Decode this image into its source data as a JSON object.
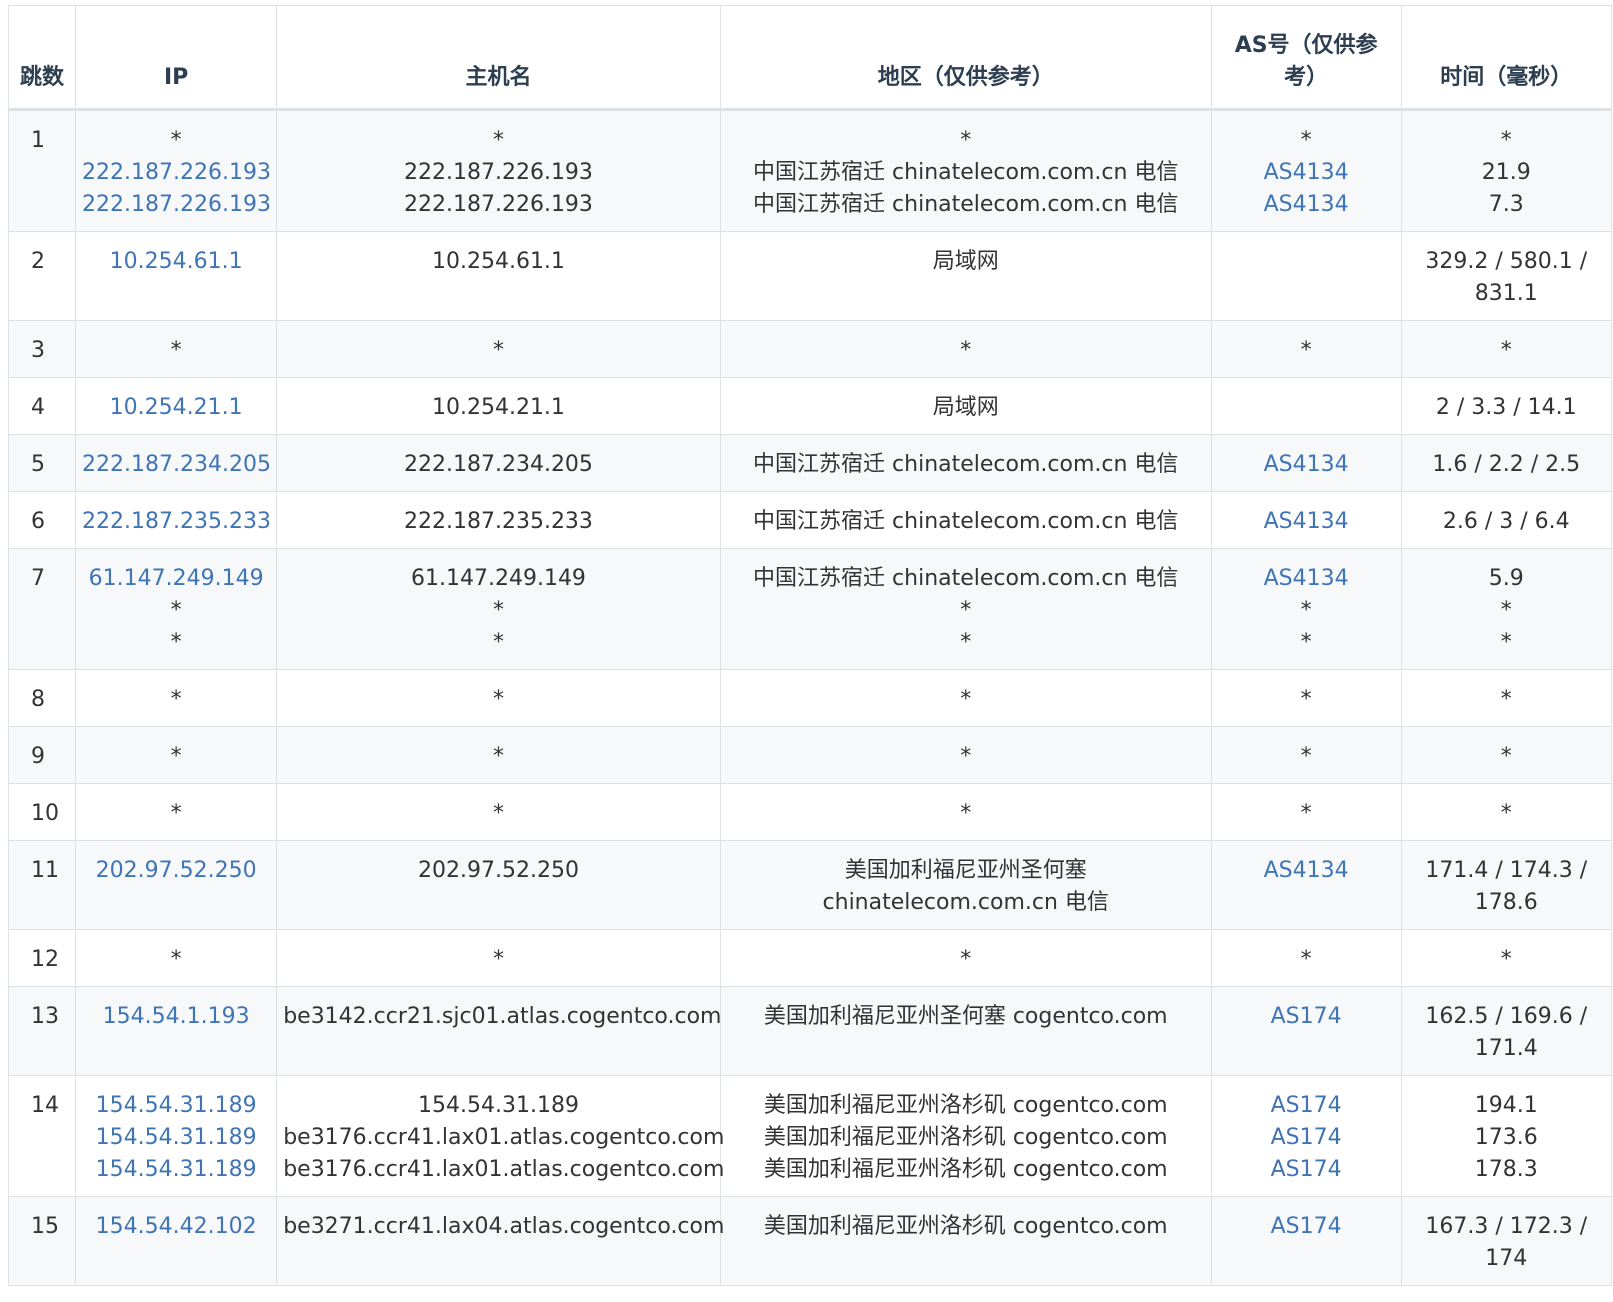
{
  "columns": [
    "跳数",
    "IP",
    "主机名",
    "地区（仅供参考）",
    "AS号（仅供参考）",
    "时间（毫秒）"
  ],
  "rows": [
    {
      "hop": "1",
      "ips": [
        "*",
        "222.187.226.193",
        "222.187.226.193"
      ],
      "hosts": [
        "*",
        "222.187.226.193",
        "222.187.226.193"
      ],
      "regions": [
        "*",
        "中国江苏宿迁 chinatelecom.com.cn 电信",
        "中国江苏宿迁 chinatelecom.com.cn 电信"
      ],
      "asns": [
        "*",
        "AS4134",
        "AS4134"
      ],
      "times": [
        "*",
        "21.9",
        "7.3"
      ]
    },
    {
      "hop": "2",
      "ips": [
        "10.254.61.1"
      ],
      "hosts": [
        "10.254.61.1"
      ],
      "regions": [
        "局域网"
      ],
      "asns": [
        ""
      ],
      "times": [
        "329.2 / 580.1 / 831.1"
      ]
    },
    {
      "hop": "3",
      "ips": [
        "*"
      ],
      "hosts": [
        "*"
      ],
      "regions": [
        "*"
      ],
      "asns": [
        "*"
      ],
      "times": [
        "*"
      ]
    },
    {
      "hop": "4",
      "ips": [
        "10.254.21.1"
      ],
      "hosts": [
        "10.254.21.1"
      ],
      "regions": [
        "局域网"
      ],
      "asns": [
        ""
      ],
      "times": [
        "2 / 3.3 / 14.1"
      ]
    },
    {
      "hop": "5",
      "ips": [
        "222.187.234.205"
      ],
      "hosts": [
        "222.187.234.205"
      ],
      "regions": [
        "中国江苏宿迁 chinatelecom.com.cn 电信"
      ],
      "asns": [
        "AS4134"
      ],
      "times": [
        "1.6 / 2.2 / 2.5"
      ]
    },
    {
      "hop": "6",
      "ips": [
        "222.187.235.233"
      ],
      "hosts": [
        "222.187.235.233"
      ],
      "regions": [
        "中国江苏宿迁 chinatelecom.com.cn 电信"
      ],
      "asns": [
        "AS4134"
      ],
      "times": [
        "2.6 / 3 / 6.4"
      ]
    },
    {
      "hop": "7",
      "ips": [
        "61.147.249.149",
        "*",
        "*"
      ],
      "hosts": [
        "61.147.249.149",
        "*",
        "*"
      ],
      "regions": [
        "中国江苏宿迁 chinatelecom.com.cn 电信",
        "*",
        "*"
      ],
      "asns": [
        "AS4134",
        "*",
        "*"
      ],
      "times": [
        "5.9",
        "*",
        "*"
      ]
    },
    {
      "hop": "8",
      "ips": [
        "*"
      ],
      "hosts": [
        "*"
      ],
      "regions": [
        "*"
      ],
      "asns": [
        "*"
      ],
      "times": [
        "*"
      ]
    },
    {
      "hop": "9",
      "ips": [
        "*"
      ],
      "hosts": [
        "*"
      ],
      "regions": [
        "*"
      ],
      "asns": [
        "*"
      ],
      "times": [
        "*"
      ]
    },
    {
      "hop": "10",
      "ips": [
        "*"
      ],
      "hosts": [
        "*"
      ],
      "regions": [
        "*"
      ],
      "asns": [
        "*"
      ],
      "times": [
        "*"
      ]
    },
    {
      "hop": "11",
      "ips": [
        "202.97.52.250"
      ],
      "hosts": [
        "202.97.52.250"
      ],
      "regions": [
        "美国加利福尼亚州圣何塞 chinatelecom.com.cn 电信"
      ],
      "asns": [
        "AS4134"
      ],
      "times": [
        "171.4 / 174.3 / 178.6"
      ]
    },
    {
      "hop": "12",
      "ips": [
        "*"
      ],
      "hosts": [
        "*"
      ],
      "regions": [
        "*"
      ],
      "asns": [
        "*"
      ],
      "times": [
        "*"
      ]
    },
    {
      "hop": "13",
      "ips": [
        "154.54.1.193"
      ],
      "hosts": [
        "be3142.ccr21.sjc01.atlas.cogentco.com"
      ],
      "regions": [
        "美国加利福尼亚州圣何塞 cogentco.com"
      ],
      "asns": [
        "AS174"
      ],
      "times": [
        "162.5 / 169.6 / 171.4"
      ]
    },
    {
      "hop": "14",
      "ips": [
        "154.54.31.189",
        "154.54.31.189",
        "154.54.31.189"
      ],
      "hosts": [
        "154.54.31.189",
        "be3176.ccr41.lax01.atlas.cogentco.com",
        "be3176.ccr41.lax01.atlas.cogentco.com"
      ],
      "regions": [
        "美国加利福尼亚州洛杉矶 cogentco.com",
        "美国加利福尼亚州洛杉矶 cogentco.com",
        "美国加利福尼亚州洛杉矶 cogentco.com"
      ],
      "asns": [
        "AS174",
        "AS174",
        "AS174"
      ],
      "times": [
        "194.1",
        "173.6",
        "178.3"
      ]
    },
    {
      "hop": "15",
      "ips": [
        "154.54.42.102"
      ],
      "hosts": [
        "be3271.ccr41.lax04.atlas.cogentco.com"
      ],
      "regions": [
        "美国加利福尼亚州洛杉矶 cogentco.com"
      ],
      "asns": [
        "AS174"
      ],
      "times": [
        "167.3 / 172.3 / 174"
      ]
    }
  ],
  "colors": {
    "link": "#3f74b5",
    "text": "#333333",
    "header_text": "#2c3e50",
    "border": "#dfe2e5",
    "row_alt": "#f6f8fa"
  }
}
